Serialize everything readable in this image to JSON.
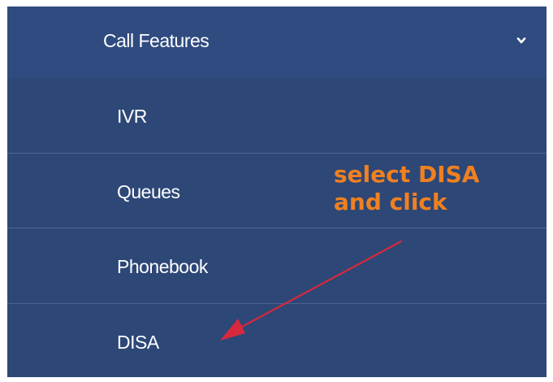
{
  "menu": {
    "header": {
      "label": "Call Features",
      "icon": "chevron-down-icon"
    },
    "items": [
      {
        "label": "IVR"
      },
      {
        "label": "Queues"
      },
      {
        "label": "Phonebook"
      },
      {
        "label": "DISA"
      }
    ]
  },
  "annotation": {
    "line1": "select DISA",
    "line2": "and click",
    "color": "#f08020",
    "arrow_color": "#d8283c"
  },
  "colors": {
    "menu_background": "#2e4a7f",
    "menu_text": "#ffffff",
    "divider": "#4c6496"
  }
}
